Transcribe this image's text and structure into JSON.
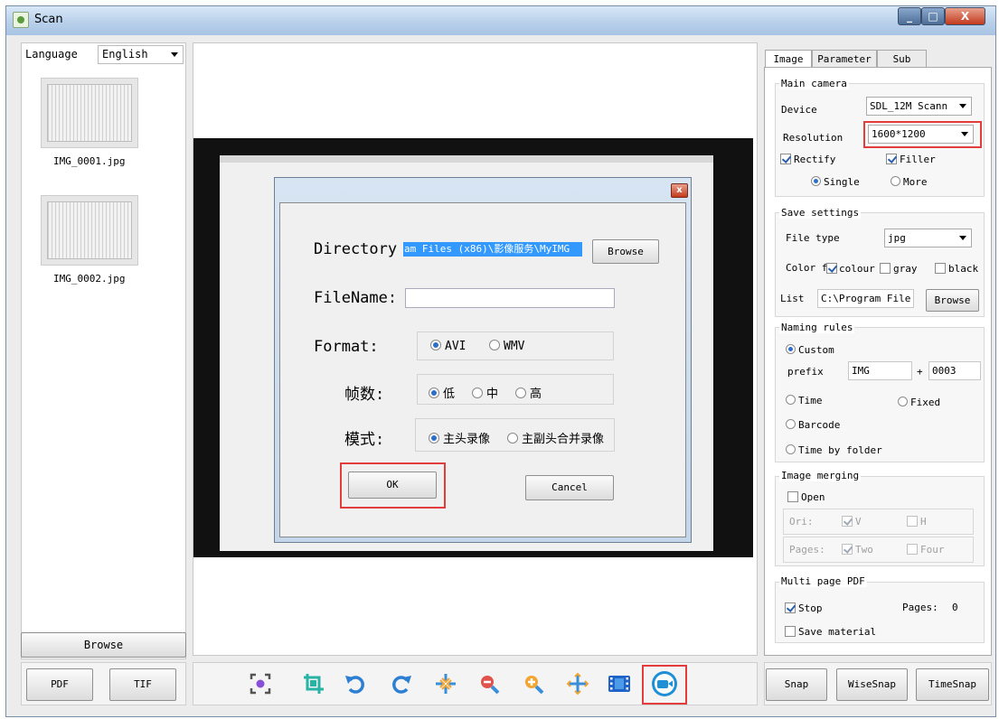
{
  "window": {
    "title": "Scan"
  },
  "left": {
    "language_label": "Language",
    "language_value": "English",
    "thumbnails": [
      "IMG_0001.jpg",
      "IMG_0002.jpg"
    ],
    "browse_label": "Browse",
    "pdf_label": "PDF",
    "tif_label": "TIF"
  },
  "dialog": {
    "directory_label": "Directory",
    "directory_value": "am Files (x86)\\影像服务\\MyIMG",
    "browse_label": "Browse",
    "filename_label": "FileName:",
    "filename_value": "",
    "format_label": "Format:",
    "format_options": [
      "AVI",
      "WMV"
    ],
    "format_selected": "AVI",
    "fps_label": "帧数:",
    "fps_options": [
      "低",
      "中",
      "高"
    ],
    "fps_selected": "低",
    "mode_label": "模式:",
    "mode_options": [
      "主头录像",
      "主副头合并录像"
    ],
    "mode_selected": "主头录像",
    "ok_label": "OK",
    "cancel_label": "Cancel",
    "close_glyph": "x"
  },
  "right": {
    "tabs": [
      "Image",
      "Parameter",
      "Sub"
    ],
    "active_tab": "Image",
    "main_camera": {
      "title": "Main camera",
      "device_label": "Device",
      "device_value": "SDL_12M Scann",
      "resolution_label": "Resolution",
      "resolution_value": "1600*1200",
      "rectify_label": "Rectify",
      "rectify_checked": true,
      "filler_label": "Filler",
      "filler_checked": true,
      "single_label": "Single",
      "more_label": "More",
      "mode_selected": "Single"
    },
    "save_settings": {
      "title": "Save settings",
      "filetype_label": "File type",
      "filetype_value": "jpg",
      "color_label": "Color f",
      "colour_label": "colour",
      "colour_checked": true,
      "gray_label": "gray",
      "gray_checked": false,
      "black_label": "black",
      "black_checked": false,
      "list_label": "List",
      "list_value": "C:\\Program File",
      "browse_label": "Browse"
    },
    "naming_rules": {
      "title": "Naming rules",
      "custom_label": "Custom",
      "prefix_label": "prefix",
      "prefix_value": "IMG",
      "plus_label": "+",
      "number_value": "0003",
      "time_label": "Time",
      "fixed_label": "Fixed",
      "barcode_label": "Barcode",
      "time_by_folder_label": "Time by folder",
      "selected": "Custom"
    },
    "image_merging": {
      "title": "Image merging",
      "open_label": "Open",
      "open_checked": false,
      "ori_label": "Ori:",
      "v_label": "V",
      "v_checked": true,
      "h_label": "H",
      "h_checked": false,
      "pages_label": "Pages:",
      "two_label": "Two",
      "two_checked": true,
      "four_label": "Four",
      "four_checked": false
    },
    "multi_page_pdf": {
      "title": "Multi page PDF",
      "stop_label": "Stop",
      "stop_checked": true,
      "pages_label": "Pages:",
      "pages_value": "0",
      "save_material_label": "Save material",
      "save_material_checked": false
    },
    "snap_label": "Snap",
    "wisesnap_label": "WiseSnap",
    "timesnap_label": "TimeSnap"
  },
  "toolbar": {
    "icons": [
      "focus-icon",
      "crop-icon",
      "rotate-left-icon",
      "rotate-right-icon",
      "shrink-icon",
      "zoom-out-icon",
      "zoom-in-icon",
      "expand-icon",
      "film-icon",
      "video-record-icon"
    ],
    "highlighted": "video-record-icon",
    "colors": {
      "crop": "#29b3a4",
      "rotate": "#2d7fd4",
      "zoom_out": "#e0534c",
      "zoom_in": "#f2a531",
      "film": "#1e64c8",
      "video": "#1f8fd6",
      "highlight": "#e23c3c"
    }
  }
}
